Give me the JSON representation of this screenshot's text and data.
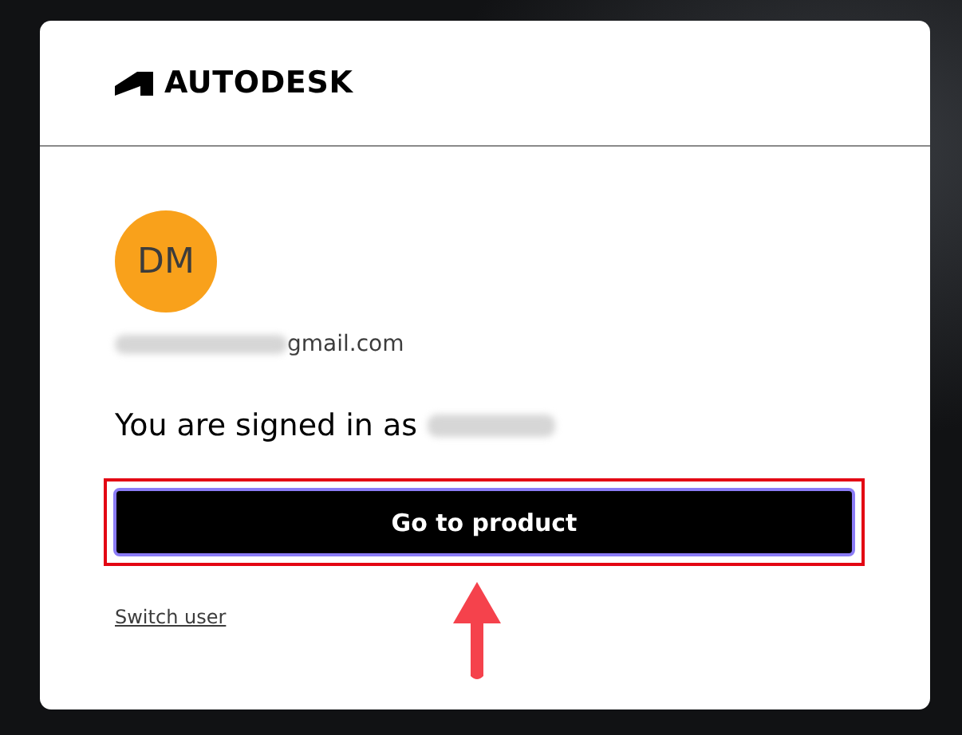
{
  "brand": {
    "name": "AUTODESK"
  },
  "account": {
    "initials": "DM",
    "email": "gmail.com",
    "email_redacted": true,
    "signed_in_text": "You are signed in as",
    "name_redacted": true
  },
  "primary_button": {
    "label": "Go to product",
    "highlighted": true
  },
  "arrow_pointer": true,
  "secondary_link": {
    "label": "Switch user"
  }
}
